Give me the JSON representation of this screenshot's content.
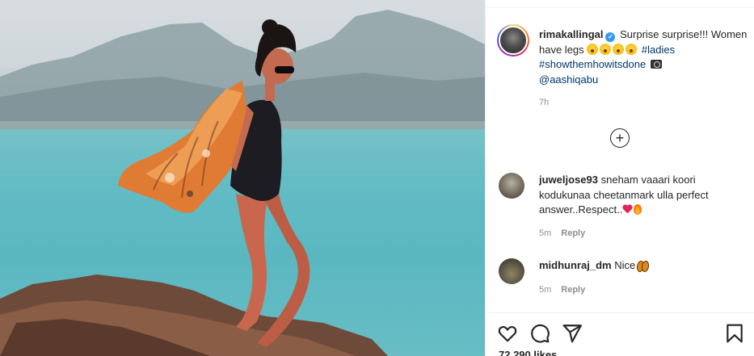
{
  "post": {
    "caption": {
      "username": "rimakallingal",
      "text_1": "Surprise surprise!!!",
      "text_2": "Women have legs",
      "hashtag_1": "#ladies",
      "hashtag_2": "#showthemhowitsdone",
      "mention": "@aashiqabu",
      "time": "7h"
    },
    "comments": [
      {
        "username": "juweljose93",
        "text": "sneham vaaari koori kodukunaa cheetanmark ulla perfect answer..Respect..",
        "time": "5m",
        "reply_label": "Reply"
      },
      {
        "username": "midhunraj_dm",
        "text": "Nice",
        "time": "5m",
        "reply_label": "Reply"
      }
    ],
    "likes_text": "72,290 likes"
  },
  "icons": {
    "verified": "verified-badge-icon",
    "load_more": "plus-circle-icon",
    "like": "heart-outline-icon",
    "comment": "comment-bubble-icon",
    "share": "paper-plane-icon",
    "save": "bookmark-icon"
  },
  "colors": {
    "link": "#00376b",
    "verified": "#3897f0",
    "muted": "#8e8e8e",
    "text": "#262626"
  }
}
